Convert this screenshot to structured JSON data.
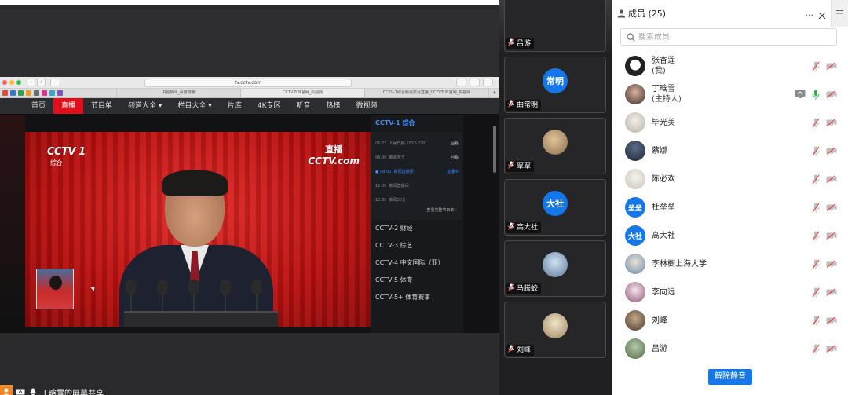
{
  "share": {
    "browser": {
      "url": "tv.cctv.com",
      "tabs": [
        "央视新闻_百度搜索",
        "CCTV节目官网_央视网",
        "CCTV-1综合频道高清直播_CCTV节目官网_央视网"
      ],
      "tab_plus": "+"
    },
    "cctv_nav": [
      "首页",
      "直播",
      "节目单",
      "频道大全 ▾",
      "栏目大全 ▾",
      "片库",
      "4K专区",
      "听音",
      "热榜",
      "微视频"
    ],
    "video": {
      "channel_logo": "CCTV 1",
      "channel_logo_sub": "综合",
      "live_badge": "直播",
      "live_badge_sub": "CCTV.com"
    },
    "channel_panel": {
      "current": "CCTV-1 综合",
      "epg": [
        {
          "time": "05:27",
          "title": "人民日报-2022-220",
          "status": "回看"
        },
        {
          "time": "06:00",
          "title": "朝闻天下",
          "status": "回看"
        },
        {
          "time": "08:00",
          "title": "新闻直播间",
          "status": "直播中"
        },
        {
          "time": "12:00",
          "title": "新闻直播间",
          "status": ""
        },
        {
          "time": "12:30",
          "title": "新闻30分",
          "status": ""
        }
      ],
      "more": "查看完整节目单 ›",
      "channels": [
        "CCTV-2 财经",
        "CCTV-3 综艺",
        "CCTV-4 中文国际（亚）",
        "CCTV-5 体育",
        "CCTV-5+ 体育赛事"
      ]
    },
    "status_label": "丁晗雪的屏幕共享"
  },
  "gallery": {
    "top_name": "吕游",
    "tiles": [
      {
        "avatar": "常明",
        "name": "曲常明"
      },
      {
        "avatar": "",
        "name": "覃覃"
      },
      {
        "avatar": "大社",
        "name": "高大社"
      },
      {
        "avatar": "",
        "name": "马腾蛟"
      },
      {
        "avatar": "",
        "name": "刘峰"
      }
    ]
  },
  "members": {
    "title": "成员 (25)",
    "search_placeholder": "搜索成员",
    "unmute_label": "解除静音",
    "list": [
      {
        "name": "张杏莲",
        "sub": "(我)",
        "avatar": ""
      },
      {
        "name": "丁晗雪",
        "sub": "(主持人)",
        "avatar": ""
      },
      {
        "name": "毕光美",
        "sub": "",
        "avatar": ""
      },
      {
        "name": "蔡娜",
        "sub": "",
        "avatar": ""
      },
      {
        "name": "陈必欢",
        "sub": "",
        "avatar": ""
      },
      {
        "name": "杜垒垒",
        "sub": "",
        "avatar": "垒垒"
      },
      {
        "name": "高大社",
        "sub": "",
        "avatar": "大社"
      },
      {
        "name": "李林橱上海大学",
        "sub": "",
        "avatar": ""
      },
      {
        "name": "李向远",
        "sub": "",
        "avatar": ""
      },
      {
        "name": "刘峰",
        "sub": "",
        "avatar": ""
      },
      {
        "name": "吕游",
        "sub": "",
        "avatar": ""
      }
    ]
  },
  "colors": {
    "accent": "#1677e8",
    "muted_red": "#e8534a",
    "cctv_red": "#e10f1a",
    "host_mic_green": "#31b24a"
  },
  "icons": {
    "muted_mic": "mic-muted-icon",
    "camera_off": "camera-off-icon",
    "screen_share": "screen-share-icon",
    "person": "person-icon",
    "search": "search-icon",
    "more": "more-icon",
    "close": "close-icon",
    "menu": "menu-icon"
  }
}
